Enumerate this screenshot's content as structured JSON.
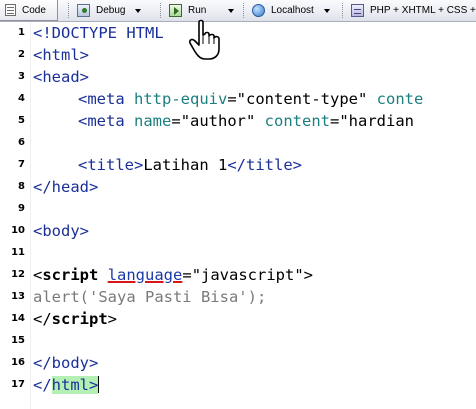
{
  "toolbar": {
    "code_label": "Code",
    "debug_label": "Debug",
    "run_label": "Run",
    "localhost_label": "Localhost",
    "php_label": "PHP + XHTML + CSS +"
  },
  "editor": {
    "lines": [
      {
        "num": "1",
        "parts": [
          "<!DOCTYPE HTML"
        ]
      },
      {
        "num": "2",
        "parts": [
          "<html>"
        ]
      },
      {
        "num": "3",
        "parts": [
          "<head>"
        ]
      },
      {
        "num": "4",
        "parts": [
          "<meta",
          " http-equiv",
          "=",
          "\"content-type\"",
          " conte"
        ]
      },
      {
        "num": "5",
        "parts": [
          "<meta",
          " name",
          "=",
          "\"author\"",
          " content",
          "=",
          "\"hardian"
        ]
      },
      {
        "num": "6",
        "parts": [
          ""
        ]
      },
      {
        "num": "7",
        "parts": [
          "<title>",
          "Latihan 1",
          "</title>"
        ]
      },
      {
        "num": "8",
        "parts": [
          "</head>"
        ]
      },
      {
        "num": "9",
        "parts": [
          ""
        ]
      },
      {
        "num": "10",
        "parts": [
          "<body>"
        ]
      },
      {
        "num": "11",
        "parts": [
          ""
        ]
      },
      {
        "num": "12",
        "parts": [
          "<",
          "script",
          " ",
          "language",
          "=",
          "\"javascript\"",
          ">"
        ]
      },
      {
        "num": "13",
        "parts": [
          "alert('Saya Pasti Bisa');"
        ]
      },
      {
        "num": "14",
        "parts": [
          "</",
          "script",
          ">"
        ]
      },
      {
        "num": "15",
        "parts": [
          ""
        ]
      },
      {
        "num": "16",
        "parts": [
          "</body>"
        ]
      },
      {
        "num": "17",
        "parts": [
          "</",
          "html",
          ">"
        ]
      }
    ]
  },
  "icons": {
    "code": "code-view-icon",
    "debug": "debug-icon",
    "run": "run-icon",
    "localhost": "globe-icon",
    "php": "php-template-icon",
    "cursor": "hand-pointer-icon"
  },
  "colors": {
    "tag": "#1a2f99",
    "attribute": "#1c7f7f",
    "js": "#7a7a7a",
    "bracket_match": "#b4f0b4",
    "error_underline": "#d81818"
  }
}
